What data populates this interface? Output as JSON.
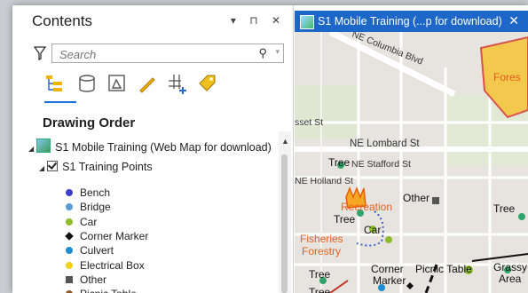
{
  "contents": {
    "title": "Contents",
    "controls": "▾ ⊓ ✕",
    "search_placeholder": "Search",
    "drawing_order": "Drawing Order",
    "map_name": "S1 Mobile Training (Web Map for download)",
    "layer_name": "S1 Training Points",
    "legend": [
      {
        "label": "Bench",
        "color": "#3f3fcf",
        "shape": "circle"
      },
      {
        "label": "Bridge",
        "color": "#5b9bd5",
        "shape": "circle"
      },
      {
        "label": "Car",
        "color": "#8dbb2a",
        "shape": "circle"
      },
      {
        "label": "Corner Marker",
        "color": "#111111",
        "shape": "diamond"
      },
      {
        "label": "Culvert",
        "color": "#1b8fd0",
        "shape": "circle"
      },
      {
        "label": "Electrical Box",
        "color": "#f0d21a",
        "shape": "circle"
      },
      {
        "label": "Other",
        "color": "#555555",
        "shape": "square"
      },
      {
        "label": "Picnic Table",
        "color": "#8b5a2b",
        "shape": "circle"
      }
    ]
  },
  "map": {
    "tab_title": "S1 Mobile Training (...p for download)",
    "tab_close": "✕",
    "labels": {
      "columbia": "NE Columbia Blvd",
      "forest_poly": "Fores",
      "sset": "sset St",
      "lombard": "NE Lombard St",
      "stafford": "NE Stafford St",
      "tree1": "Tree",
      "holland": "NE Holland St",
      "other": "Other",
      "recreation": "Recreation",
      "tree2": "Tree",
      "tree3": "Tree",
      "car": "Car",
      "fisheries": "Fisheries",
      "forestry": "Forestry",
      "tree4": "Tree",
      "corner": "Corner",
      "marker": "Marker",
      "picnic": "Picnic Table",
      "grassy": "Grassy",
      "area": "Area",
      "tree5": "Tree"
    }
  }
}
